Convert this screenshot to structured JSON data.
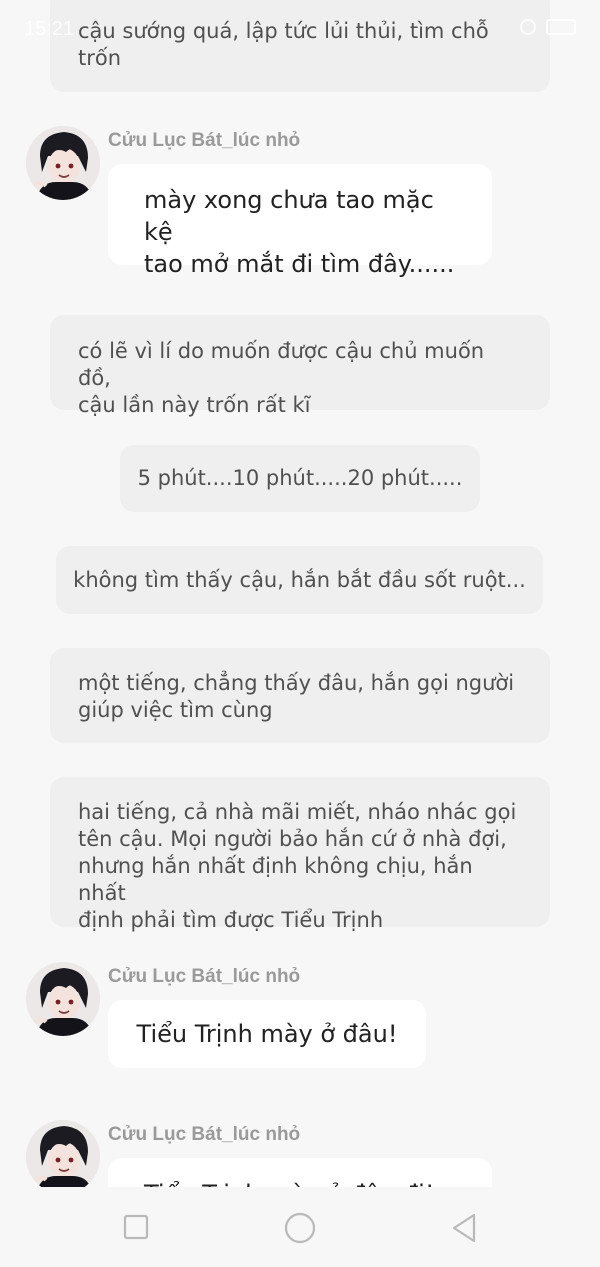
{
  "status_bar": {
    "time": "15:21"
  },
  "messages": [
    {
      "type": "narration",
      "lines": [
        "cậu sướng quá, lập tức lủi thủi, tìm chỗ",
        "trốn"
      ]
    },
    {
      "type": "chat",
      "sender": "Cửu Lục Bát_lúc nhỏ",
      "lines": [
        "mày xong chưa tao mặc kệ",
        "tao mở mắt đi tìm đây......"
      ]
    },
    {
      "type": "narration",
      "lines": [
        "có lẽ vì lí do muốn được cậu chủ muốn đồ,",
        "cậu lần này trốn rất kĩ"
      ]
    },
    {
      "type": "narration",
      "lines": [
        "5 phút....10 phút.....20 phút....."
      ]
    },
    {
      "type": "narration",
      "lines": [
        "không tìm thấy cậu, hắn bắt đầu sốt ruột..."
      ]
    },
    {
      "type": "narration",
      "lines": [
        "một tiếng, chẳng thấy đâu, hắn gọi người",
        "giúp việc tìm cùng"
      ]
    },
    {
      "type": "narration",
      "lines": [
        "hai tiếng, cả nhà mãi miết, nháo nhác gọi",
        "tên cậu. Mọi người bảo hắn cứ ở nhà đợi,",
        "nhưng hắn nhất định không chịu, hắn nhất",
        "định phải tìm được Tiểu Trịnh"
      ]
    },
    {
      "type": "chat",
      "sender": "Cửu Lục Bát_lúc nhỏ",
      "lines": [
        "Tiểu Trịnh mày ở đâu!"
      ]
    },
    {
      "type": "chat",
      "sender": "Cửu Lục Bát_lúc nhỏ",
      "lines": [
        "Tiểu Trịnh mày ở đâu đi!"
      ]
    }
  ],
  "colors": {
    "background": "#f7f7f7",
    "narration_bg": "#efefef",
    "bubble_bg": "#ffffff",
    "sender_text": "#9a9a9a"
  },
  "nav": {
    "icons": [
      "square-icon",
      "circle-icon",
      "triangle-back-icon"
    ]
  }
}
